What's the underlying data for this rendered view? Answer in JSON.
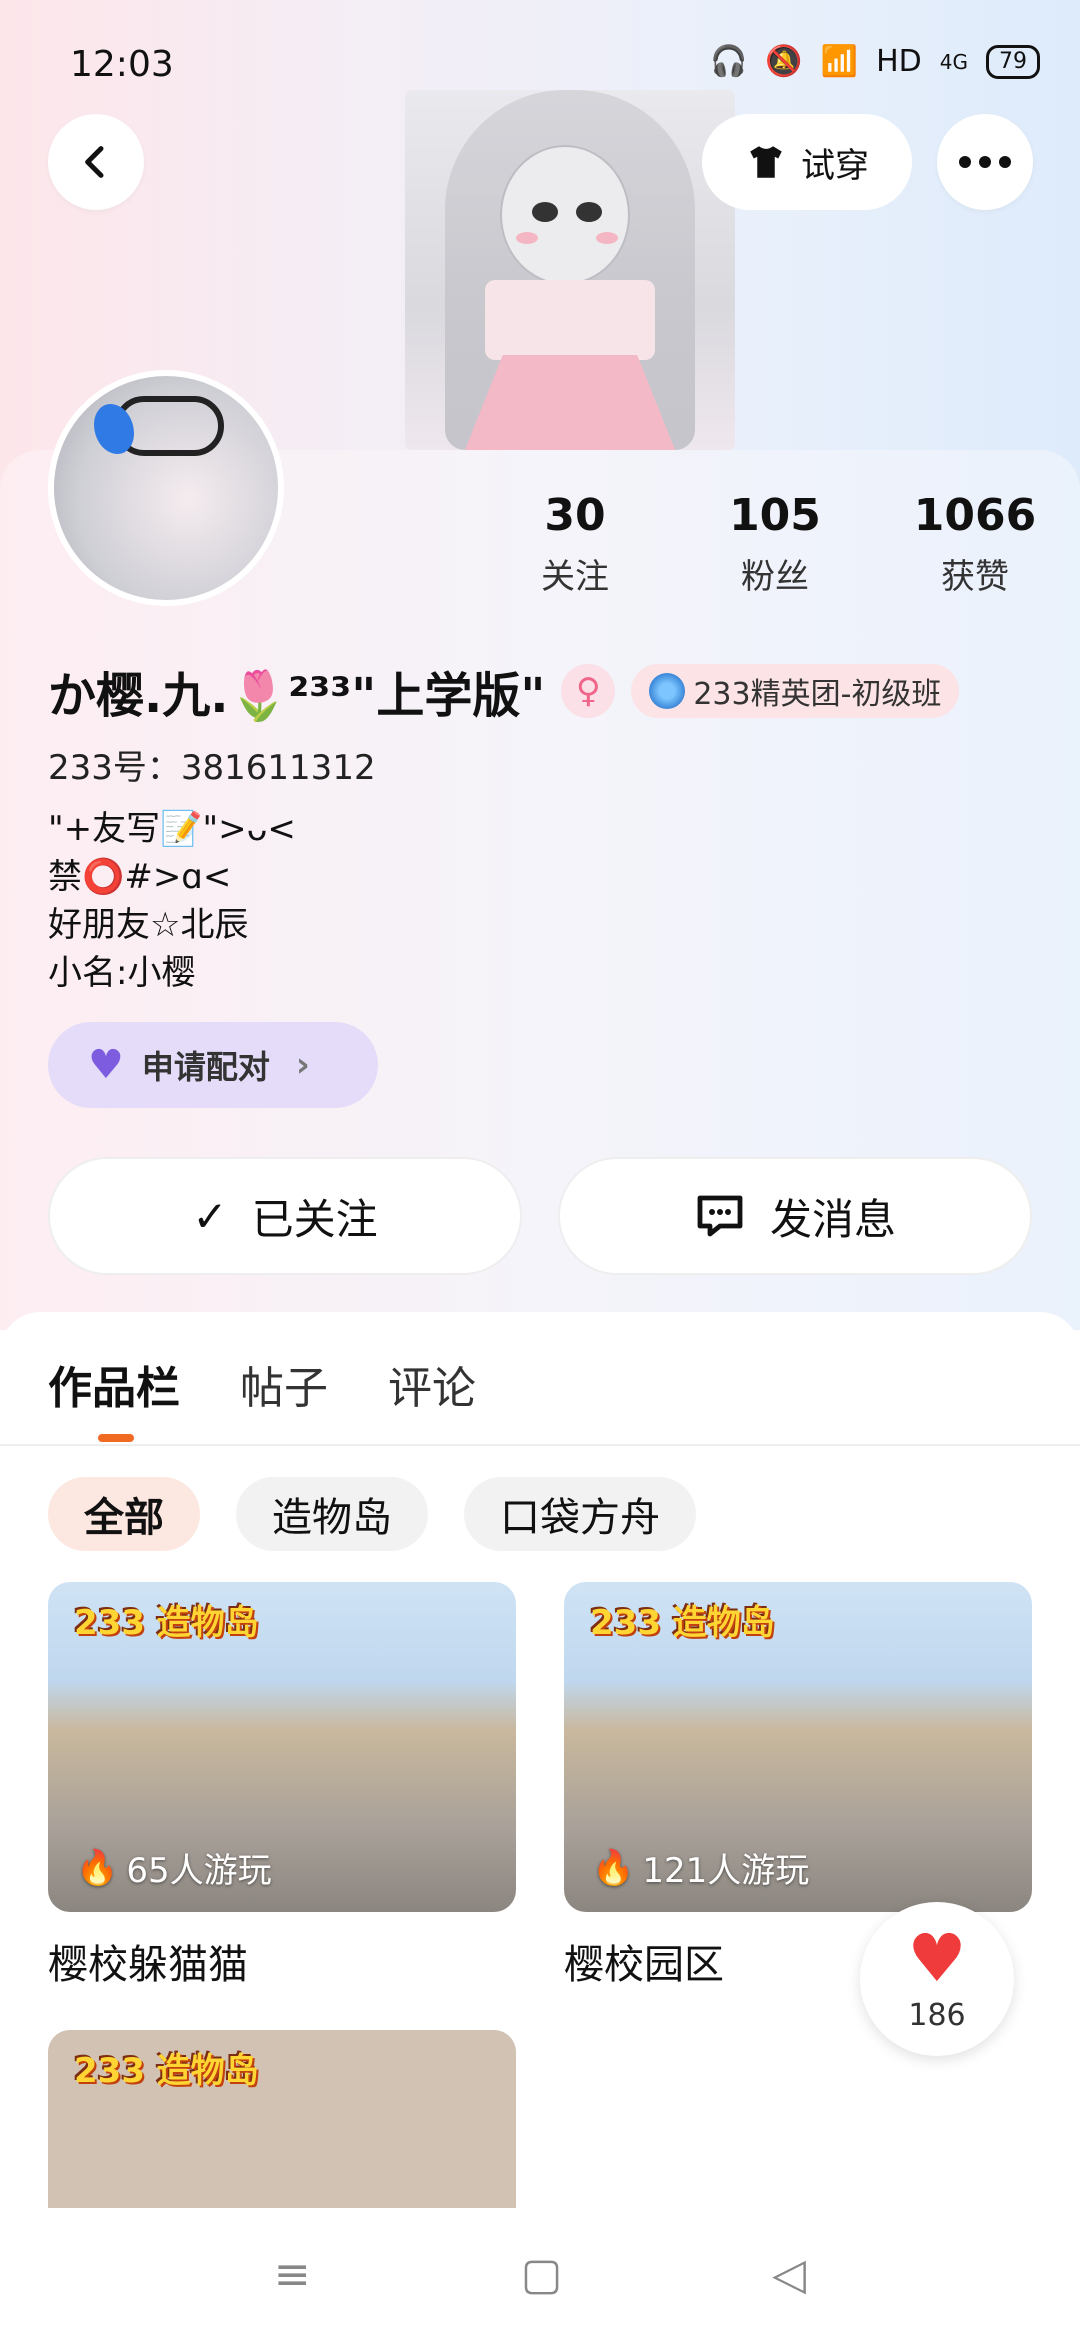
{
  "status_bar": {
    "time": "12:03",
    "battery": "79",
    "network": "HD",
    "signal": "4G"
  },
  "header": {
    "try_on_label": "试穿",
    "more_icon": "ellipsis-icon",
    "back_icon": "chevron-left-icon"
  },
  "stats": [
    {
      "value": "30",
      "label": "关注"
    },
    {
      "value": "105",
      "label": "粉丝"
    },
    {
      "value": "1066",
      "label": "获赞"
    }
  ],
  "profile": {
    "name": "か樱.九.🌷²³³\"上学版\"",
    "gender_symbol": "♀",
    "badge": "233精英团-初级班",
    "uid": "233号：381611312",
    "bio": [
      "\"+友写📝\">ᴗ<",
      "禁⭕#>ɑ<",
      "好朋友☆北辰",
      "小名:小樱"
    ]
  },
  "pair_button": {
    "label": "申请配对",
    "chevron": "›"
  },
  "actions": {
    "follow_label": "已关注",
    "follow_icon": "✓",
    "message_label": "发消息"
  },
  "tabs": [
    "作品栏",
    "帖子",
    "评论"
  ],
  "filters": [
    "全部",
    "造物岛",
    "口袋方舟"
  ],
  "works": [
    {
      "title": "樱校躲猫猫",
      "plays": "65人游玩",
      "logo": "233 造物岛"
    },
    {
      "title": "樱校园区",
      "plays": "121人游玩",
      "logo": "233 造物岛"
    },
    {
      "title": "",
      "plays": "",
      "logo": "233 造物岛"
    }
  ],
  "like_float": {
    "count": "186"
  },
  "nav": {
    "menu": "≡",
    "home": "▢",
    "back": "◁"
  }
}
